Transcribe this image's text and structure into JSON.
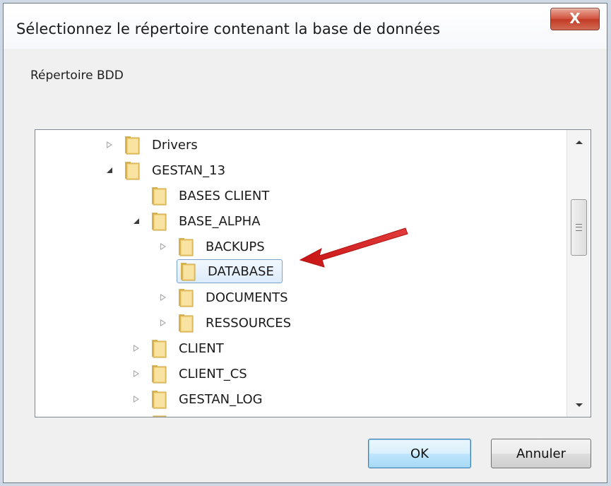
{
  "window": {
    "title": "Sélectionnez le répertoire contenant la base de données",
    "close_label": "X"
  },
  "label": "Répertoire BDD",
  "tree": [
    {
      "label": "Drivers",
      "state": "collapsed",
      "level": 0
    },
    {
      "label": "GESTAN_13",
      "state": "expanded",
      "level": 0
    },
    {
      "label": "BASES CLIENT",
      "state": "leaf",
      "level": 1
    },
    {
      "label": "BASE_ALPHA",
      "state": "expanded",
      "level": 1
    },
    {
      "label": "BACKUPS",
      "state": "collapsed",
      "level": 2
    },
    {
      "label": "DATABASE",
      "state": "leaf",
      "level": 2,
      "selected": true
    },
    {
      "label": "DOCUMENTS",
      "state": "collapsed",
      "level": 2
    },
    {
      "label": "RESSOURCES",
      "state": "collapsed",
      "level": 2
    },
    {
      "label": "CLIENT",
      "state": "collapsed",
      "level": 1
    },
    {
      "label": "CLIENT_CS",
      "state": "collapsed",
      "level": 1
    },
    {
      "label": "GESTAN_LOG",
      "state": "collapsed",
      "level": 1
    }
  ],
  "buttons": {
    "ok": "OK",
    "cancel": "Annuler"
  },
  "colors": {
    "selection_border": "#7da2ce",
    "annotation_arrow": "#d81e1e",
    "close_button": "#c23a26"
  }
}
